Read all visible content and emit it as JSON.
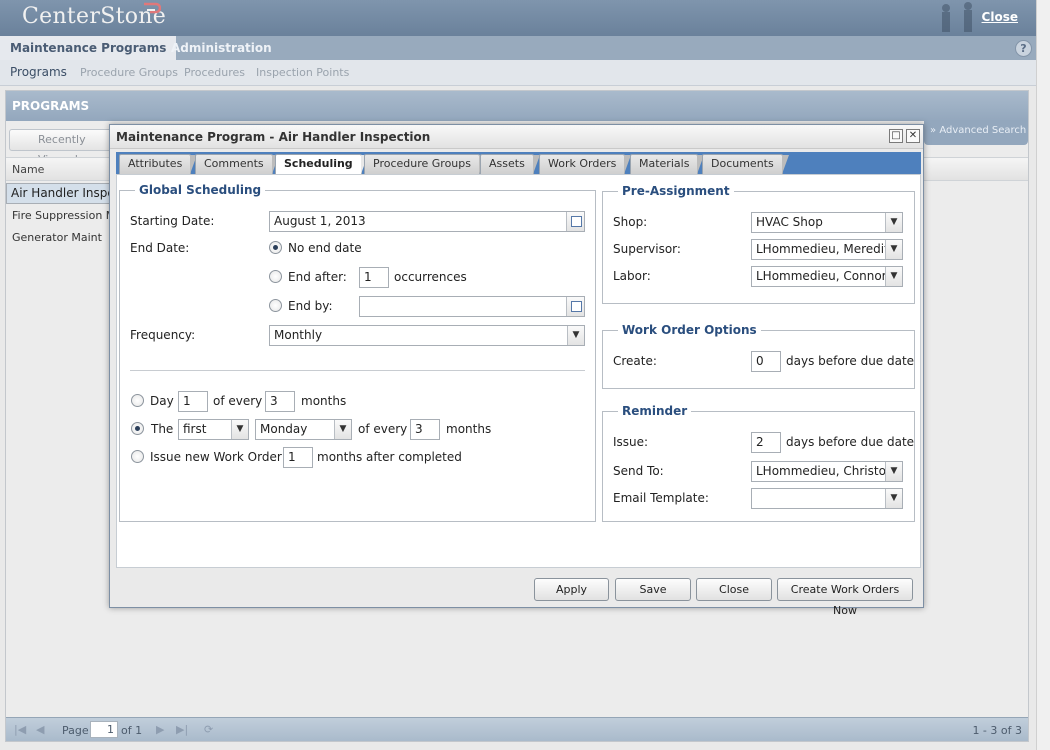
{
  "header": {
    "brand": "CenterStone",
    "close_label": "Close"
  },
  "nav": {
    "tabs": [
      "Maintenance Programs",
      "Administration"
    ],
    "help": "?"
  },
  "subnav": {
    "items": [
      "Programs",
      "Procedure Groups",
      "Procedures",
      "Inspection Points"
    ]
  },
  "programs": {
    "title": "PROGRAMS",
    "recently_viewed": "Recently Viewed",
    "advanced_search": "Advanced Search",
    "column_name": "Name",
    "rows": [
      "Air Handler Inspection",
      "Fire Suppression Maint",
      "Generator Maint"
    ],
    "pager": {
      "page_label": "Page",
      "page_value": "1",
      "of_label": "of 1",
      "count": "1 - 3 of 3"
    }
  },
  "dialog": {
    "title": "Maintenance Program - Air Handler Inspection",
    "tabs": [
      "Attributes",
      "Comments",
      "Scheduling",
      "Procedure Groups",
      "Assets",
      "Work Orders",
      "Materials",
      "Documents"
    ],
    "active_tab": "Scheduling",
    "global": {
      "legend": "Global Scheduling",
      "starting_date_label": "Starting Date:",
      "starting_date": "August 1, 2013",
      "end_date_label": "End Date:",
      "no_end_date": "No end date",
      "end_after": "End after:",
      "end_after_value": "1",
      "occurrences": "occurrences",
      "end_by": "End by:",
      "end_by_value": "",
      "frequency_label": "Frequency:",
      "frequency": "Monthly",
      "day_label": "Day",
      "day_value": "1",
      "of_every": "of every",
      "months": "months",
      "day_months_value": "3",
      "the_label": "The",
      "ordinal": "first",
      "weekday": "Monday",
      "the_of_every": "of every",
      "the_months_value": "3",
      "the_months": "months",
      "issue_label": "Issue new Work Order",
      "issue_value": "1",
      "issue_after": "months after completed"
    },
    "preassign": {
      "legend": "Pre-Assignment",
      "shop_label": "Shop:",
      "shop": "HVAC Shop",
      "supervisor_label": "Supervisor:",
      "supervisor": "LHommedieu, Meredith",
      "labor_label": "Labor:",
      "labor": "LHommedieu, Connor"
    },
    "wo_options": {
      "legend": "Work Order Options",
      "create_label": "Create:",
      "create_value": "0",
      "days_before": "days before due date"
    },
    "reminder": {
      "legend": "Reminder",
      "issue_label": "Issue:",
      "issue_value": "2",
      "days_before": "days before due date",
      "send_to_label": "Send To:",
      "send_to": "LHommedieu, Christoph",
      "email_template_label": "Email Template:",
      "email_template": ""
    },
    "buttons": {
      "apply": "Apply",
      "save": "Save",
      "close": "Close",
      "create": "Create Work Orders Now"
    }
  }
}
